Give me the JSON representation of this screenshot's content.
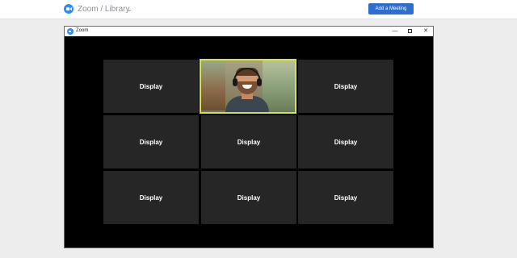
{
  "header": {
    "breadcrumb": "Zoom / Library",
    "add_meeting_label": "Add a Meeting"
  },
  "window": {
    "title": "Zoom",
    "controls": {
      "minimize": "—",
      "close": "✕"
    }
  },
  "grid": {
    "tiles": [
      {
        "label": "Display"
      },
      {
        "label": "",
        "active": true
      },
      {
        "label": "Display"
      },
      {
        "label": "Display"
      },
      {
        "label": "Display"
      },
      {
        "label": "Display"
      },
      {
        "label": "Display"
      },
      {
        "label": "Display"
      },
      {
        "label": "Display"
      }
    ]
  },
  "colors": {
    "accent": "#2d8cff",
    "button": "#2d6fd1",
    "active_tile_border": "#d6e04a",
    "tile_bg": "#262626"
  },
  "icons": {
    "app_logo": "zoom-camera-icon",
    "breadcrumb_chevron": "chevron-down-icon"
  }
}
